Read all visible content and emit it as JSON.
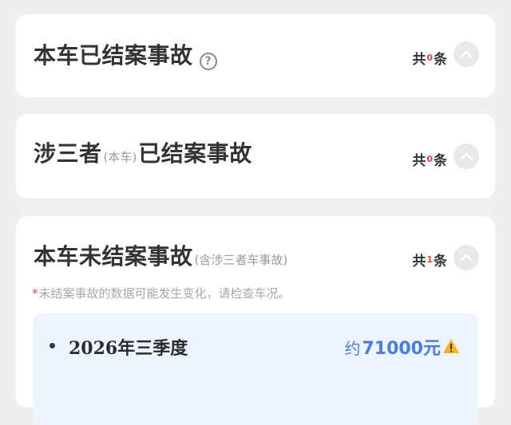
{
  "cards": [
    {
      "title": "本车已结案事故",
      "count": {
        "prefix": "共",
        "value": "0",
        "suffix": "条"
      }
    },
    {
      "title_main": "涉三者",
      "title_note": "(本车)",
      "title_rest": "已结案事故",
      "count": {
        "prefix": "共",
        "value": "0",
        "suffix": "条"
      }
    },
    {
      "title": "本车未结案事故",
      "title_note": "(含涉三者车事故)",
      "count": {
        "prefix": "共",
        "value": "1",
        "suffix": "条"
      },
      "warning": {
        "mark": "*",
        "text": "未结案事故的数据可能发生变化，请检查车况。"
      },
      "items": [
        {
          "quarter": "2026年三季度",
          "amount_prefix": "约",
          "amount": "71000元"
        }
      ]
    }
  ],
  "colors": {
    "background": "#efeff1",
    "card": "#ffffff",
    "accent_blue": "#4a7be8",
    "alert_red": "#e0443a",
    "warning_yellow": "#f2b61c"
  }
}
